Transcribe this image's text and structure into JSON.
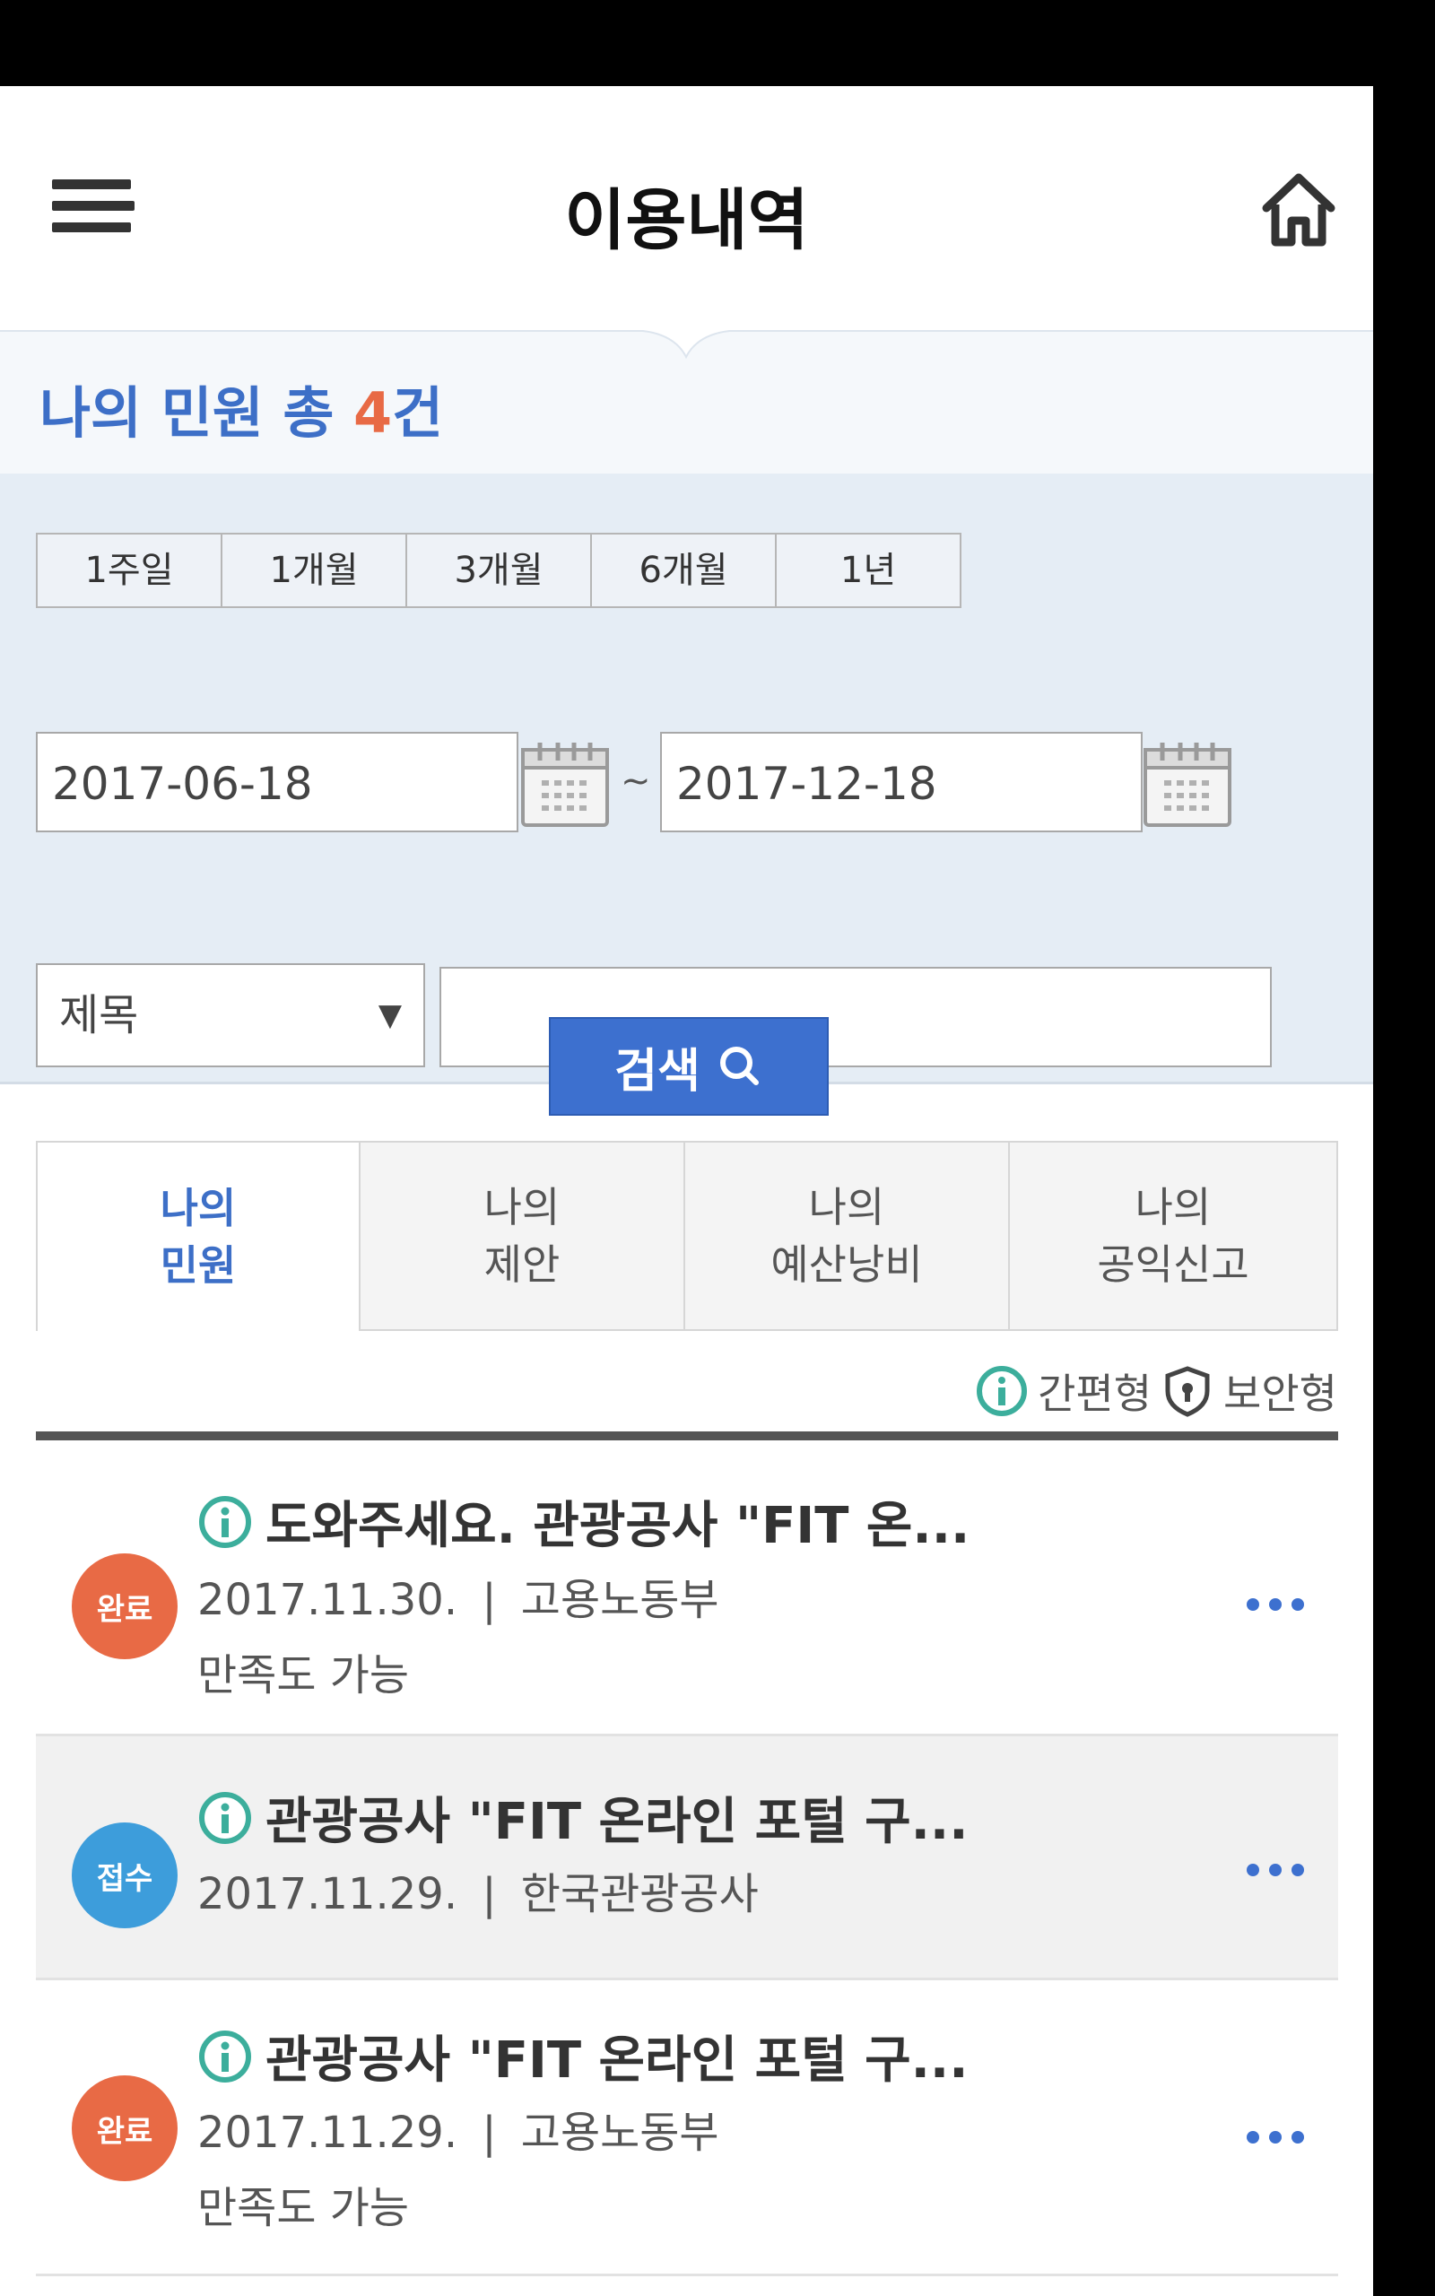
{
  "header": {
    "title": "이용내역",
    "menu_icon": "hamburger-menu-icon",
    "home_icon": "home-icon"
  },
  "summary": {
    "prefix": "나의 민원 총 ",
    "count": "4",
    "suffix": "건"
  },
  "period_buttons": [
    "1주일",
    "1개월",
    "3개월",
    "6개월",
    "1년"
  ],
  "date_range": {
    "start": "2017-06-18",
    "separator": "~",
    "end": "2017-12-18"
  },
  "search": {
    "field_selected": "제목",
    "keyword": "",
    "button_label": "검색"
  },
  "tabs": [
    "나의\n민원",
    "나의\n제안",
    "나의\n예산낭비",
    "나의\n공익신고"
  ],
  "legend": {
    "simple": "간편형",
    "secure": "보안형"
  },
  "colors": {
    "accent": "#3d70cf",
    "complete": "#e86a45",
    "received": "#3d9ddb"
  },
  "items": [
    {
      "status": "완료",
      "title": "도와주세요. 관광공사 \"FIT 온...",
      "date": "2017.11.30.",
      "sep": "|",
      "agency": "고용노동부",
      "note": "만족도 가능"
    },
    {
      "status": "접수",
      "title": "관광공사 \"FIT 온라인 포털 구...",
      "date": "2017.11.29.",
      "sep": "|",
      "agency": "한국관광공사",
      "note": ""
    },
    {
      "status": "완료",
      "title": "관광공사 \"FIT 온라인 포털 구...",
      "date": "2017.11.29.",
      "sep": "|",
      "agency": "고용노동부",
      "note": "만족도 가능"
    }
  ]
}
